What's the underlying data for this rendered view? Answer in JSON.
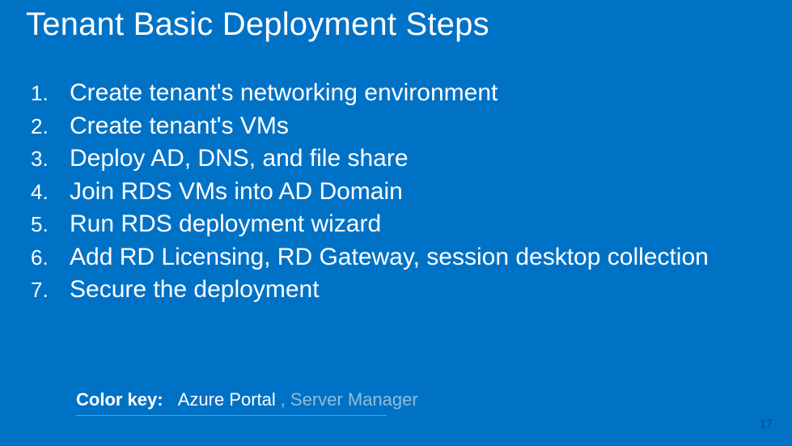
{
  "title": "Tenant Basic Deployment Steps",
  "steps": [
    {
      "num": "1.",
      "text": "Create tenant's networking environment"
    },
    {
      "num": "2.",
      "text": "Create tenant's VMs"
    },
    {
      "num": "3.",
      "text": "Deploy AD, DNS, and file share"
    },
    {
      "num": "4.",
      "text": "Join RDS VMs into AD Domain"
    },
    {
      "num": "5.",
      "text": "Run RDS deployment wizard"
    },
    {
      "num": "6.",
      "text": "Add RD Licensing, RD Gateway, session desktop collection"
    },
    {
      "num": "7.",
      "text": "Secure the deployment"
    }
  ],
  "colorKey": {
    "label": "Color key:",
    "azure": "Azure Portal",
    "separator": ",",
    "server": "Server Manager"
  },
  "pageNumber": "17"
}
